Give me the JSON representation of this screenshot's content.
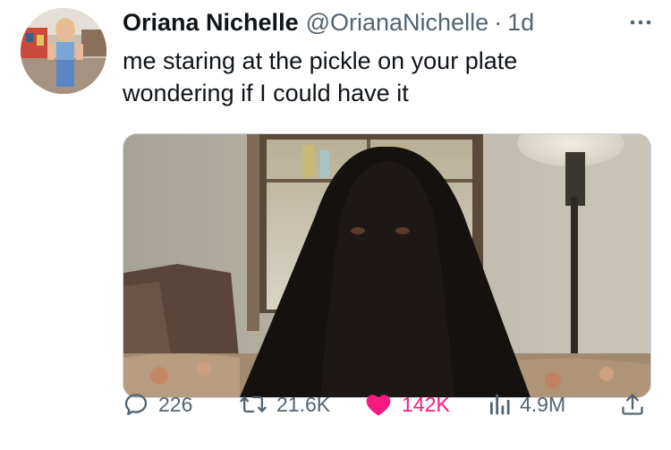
{
  "author": {
    "name": "Oriana Nichelle",
    "handle": "@OrianaNichelle",
    "separator": "·",
    "time": "1d"
  },
  "tweet": {
    "lines": [
      "me staring at the pickle on your plate",
      "wondering if I could have it"
    ]
  },
  "actions": {
    "reply_count": "226",
    "retweet_count": "21.6K",
    "like_count": "142K",
    "views_count": "4.9M"
  },
  "icons": {
    "more": "more-horizontal-icon",
    "reply": "reply-icon",
    "retweet": "retweet-icon",
    "like": "heart-filled-icon",
    "views": "views-bar-chart-icon",
    "share": "share-upload-icon"
  },
  "colors": {
    "text": "#0f1419",
    "secondary": "#536471",
    "like": "#f91880"
  }
}
